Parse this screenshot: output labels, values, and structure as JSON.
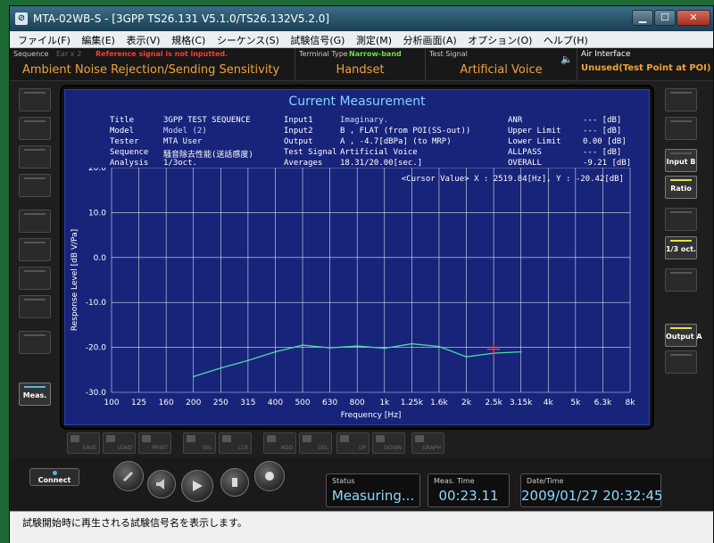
{
  "window": {
    "title": "MTA-02WB-S - [3GPP TS26.131 V5.1.0/TS26.132V5.2.0]",
    "app_icon": "app-icon",
    "controls": [
      "minimize-icon",
      "maximize-icon",
      "close-icon"
    ]
  },
  "menu": [
    "ファイル(F)",
    "編集(E)",
    "表示(V)",
    "規格(C)",
    "シーケンス(S)",
    "試験信号(G)",
    "測定(M)",
    "分析画面(A)",
    "オプション(O)",
    "ヘルプ(H)"
  ],
  "infobar": {
    "sequence_label": "Sequence",
    "ear_label": "Ear x 2",
    "warning": "Reference signal is not inputted.",
    "sequence_value": "Ambient Noise Rejection/Sending Sensitivity",
    "terminal_label": "Terminal Type",
    "terminal_band": "Narrow-band",
    "terminal_value": "Handset",
    "signal_label": "Test Signal",
    "signal_value": "Artificial Voice",
    "air_label": "Air Interface",
    "air_value": "Unused(Test Point at POI)",
    "colors": {
      "orange": "#f2a13c",
      "red_warning": "#ff3c2c",
      "green_band": "#6fdc4c"
    }
  },
  "left_buttons": [
    {
      "label": "",
      "active": false
    },
    {
      "label": "",
      "active": false
    },
    {
      "label": "",
      "active": false
    },
    {
      "label": "",
      "active": false
    },
    {
      "label": "",
      "active": false
    },
    {
      "label": "",
      "active": false
    },
    {
      "label": "",
      "active": false
    },
    {
      "label": "",
      "active": false
    },
    {
      "label": "",
      "active": false
    },
    {
      "label": "Meas.",
      "active": true
    }
  ],
  "right_buttons": [
    {
      "label": "",
      "active": false
    },
    {
      "label": "",
      "active": false
    },
    {
      "label": "Input B",
      "active": true
    },
    {
      "label": "Ratio",
      "active": true
    },
    {
      "label": "",
      "active": false
    },
    {
      "label": "1/3 oct.",
      "active": true
    },
    {
      "label": "",
      "active": false
    },
    {
      "label": "Output A",
      "active": true
    },
    {
      "label": "",
      "active": false
    }
  ],
  "display": {
    "title": "Current Measurement",
    "info": {
      "title_label": "Title",
      "title_value": "3GPP TEST SEQUENCE",
      "model_label": "Model",
      "model_value": "Model (2)",
      "tester_label": "Tester",
      "tester_value": "MTA User",
      "sequence_label": "Sequence",
      "sequence_value": "騒音除去性能(送話感度)",
      "analysis_label": "Analysis",
      "analysis_value": "1/3oct.",
      "input1_label": "Input1",
      "input1_value": "Imaginary.",
      "input2_label": "Input2",
      "input2_value": "B , FLAT (from POI(SS-out))",
      "output_label": "Output",
      "output_value": "A , -4.7[dBPa] (to MRP)",
      "test_signal_label": "Test Signal",
      "test_signal_value": "Artificial Voice",
      "averages_label": "Averages",
      "averages_value": "18.31/20.00[sec.]",
      "anr_label": "ANR",
      "anr_value": "--- [dB]",
      "upper_label": "Upper Limit",
      "upper_value": "--- [dB]",
      "lower_label": "Lower Limit",
      "lower_value": "0.00 [dB]",
      "allpass_label": "ALLPASS",
      "allpass_value": "--- [dB]",
      "overall_label": "OVERALL",
      "overall_value": "-9.21 [dB]"
    },
    "cursor_text": "<Cursor Value> X : 2519.84[Hz], Y : -20.42[dB]"
  },
  "chart_data": {
    "type": "line",
    "xlabel": "Frequency [Hz]",
    "ylabel": "Response Level [dB V/Pa]",
    "categories": [
      "100",
      "125",
      "160",
      "200",
      "250",
      "315",
      "400",
      "500",
      "630",
      "800",
      "1k",
      "1.25k",
      "1.6k",
      "2k",
      "2.5k",
      "3.15k",
      "4k",
      "5k",
      "6.3k",
      "8k"
    ],
    "y_ticks": [
      "20.0",
      "10.0",
      "0.0",
      "-10.0",
      "-20.0",
      "-30.0"
    ],
    "ylim": [
      -30,
      20
    ],
    "grid": true,
    "series": [
      {
        "x": [
          "200",
          "250",
          "315",
          "400",
          "500",
          "630",
          "800",
          "1k",
          "1.25k",
          "1.6k",
          "2k",
          "2.5k",
          "3.15k"
        ],
        "values": [
          -26.5,
          -24.6,
          -22.9,
          -21.0,
          -19.5,
          -20.1,
          -19.7,
          -20.2,
          -19.2,
          -19.8,
          -22.1,
          -21.3,
          -21.0
        ],
        "color": "#4fd6a8"
      }
    ],
    "cursor": {
      "x": "2.5k",
      "y": -20.42,
      "color": "#ff3c2c"
    }
  },
  "toolbar": [
    {
      "label": "SAVE"
    },
    {
      "label": "LOAD"
    },
    {
      "label": "PRINT"
    },
    {
      "label": "SEL"
    },
    {
      "label": "CLR"
    },
    {
      "label": "ADD"
    },
    {
      "label": "DEL"
    },
    {
      "label": "UP"
    },
    {
      "label": "DOWN"
    },
    {
      "label": "GRAPH"
    }
  ],
  "bottom": {
    "connect_label": "Connect",
    "status_label": "Status",
    "status_value": "Measuring...",
    "time_label": "Meas. Time",
    "time_value": "00:23.11",
    "date_label": "Date/Time",
    "date_value": "2009/01/27  20:32:45"
  },
  "statusbar": {
    "text": "試験開始時に再生される試験信号名を表示します。"
  }
}
